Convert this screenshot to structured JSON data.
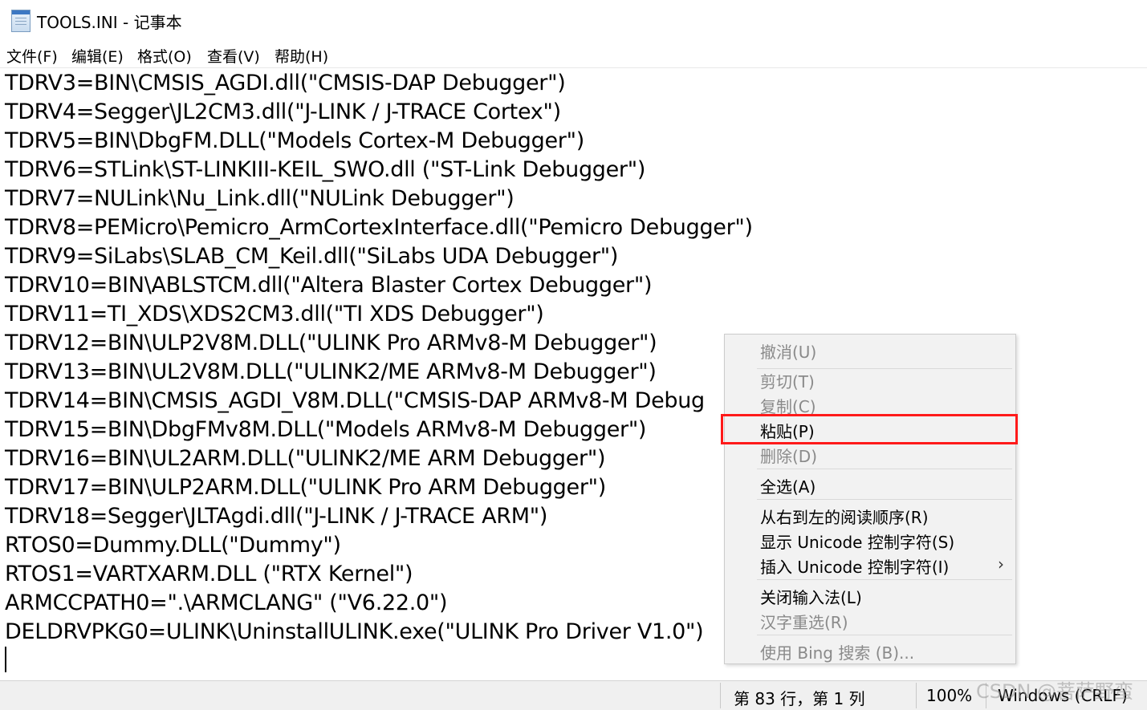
{
  "window": {
    "title": "TOOLS.INI - 记事本"
  },
  "menu": [
    "文件(F)",
    "编辑(E)",
    "格式(O)",
    "查看(V)",
    "帮助(H)"
  ],
  "lines": [
    "TDRV3=BIN\\CMSIS_AGDI.dll(\"CMSIS-DAP Debugger\")",
    "TDRV4=Segger\\JL2CM3.dll(\"J-LINK / J-TRACE Cortex\")",
    "TDRV5=BIN\\DbgFM.DLL(\"Models Cortex-M Debugger\")",
    "TDRV6=STLink\\ST-LINKIII-KEIL_SWO.dll (\"ST-Link Debugger\")",
    "TDRV7=NULink\\Nu_Link.dll(\"NULink Debugger\")",
    "TDRV8=PEMicro\\Pemicro_ArmCortexInterface.dll(\"Pemicro Debugger\")",
    "TDRV9=SiLabs\\SLAB_CM_Keil.dll(\"SiLabs UDA Debugger\")",
    "TDRV10=BIN\\ABLSTCM.dll(\"Altera Blaster Cortex Debugger\")",
    "TDRV11=TI_XDS\\XDS2CM3.dll(\"TI XDS Debugger\")",
    "TDRV12=BIN\\ULP2V8M.DLL(\"ULINK Pro ARMv8-M Debugger\")",
    "TDRV13=BIN\\UL2V8M.DLL(\"ULINK2/ME ARMv8-M Debugger\")",
    "TDRV14=BIN\\CMSIS_AGDI_V8M.DLL(\"CMSIS-DAP ARMv8-M Debug",
    "TDRV15=BIN\\DbgFMv8M.DLL(\"Models ARMv8-M Debugger\")",
    "TDRV16=BIN\\UL2ARM.DLL(\"ULINK2/ME ARM Debugger\")",
    "TDRV17=BIN\\ULP2ARM.DLL(\"ULINK Pro ARM Debugger\")",
    "TDRV18=Segger\\JLTAgdi.dll(\"J-LINK / J-TRACE ARM\")",
    "RTOS0=Dummy.DLL(\"Dummy\")",
    "RTOS1=VARTXARM.DLL (\"RTX Kernel\")",
    "ARMCCPATH0=\".\\ARMCLANG\" (\"V6.22.0\")",
    "DELDRVPKG0=ULINK\\UninstallULINK.exe(\"ULINK Pro Driver V1.0\")"
  ],
  "context_menu": {
    "undo": "撤消(U)",
    "cut": "剪切(T)",
    "copy": "复制(C)",
    "paste": "粘贴(P)",
    "delete": "删除(D)",
    "select_all": "全选(A)",
    "rtl": "从右到左的阅读顺序(R)",
    "show_unicode": "显示 Unicode 控制字符(S)",
    "insert_unicode": "插入 Unicode 控制字符(I)",
    "close_ime": "关闭输入法(L)",
    "reconvert": "汉字重选(R)",
    "bing": "使用 Bing 搜索 (B)..."
  },
  "status": {
    "position": "第 83 行，第 1 列",
    "zoom": "100%",
    "encoding": "Windows (CRLF)"
  },
  "watermark": "CSDN @菩萨野蛮"
}
